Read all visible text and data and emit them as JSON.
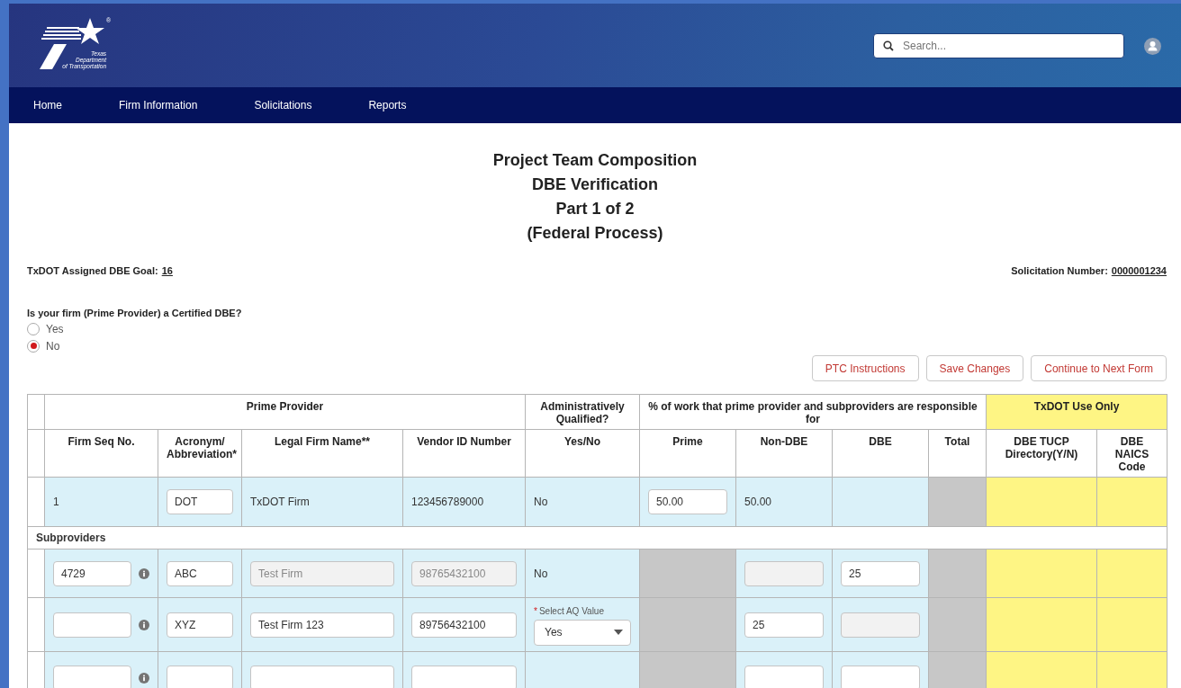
{
  "header": {
    "logo_text": [
      "Texas",
      "Department",
      "of Transportation"
    ],
    "logo_mark": "®",
    "search": {
      "placeholder": "Search..."
    }
  },
  "nav": [
    {
      "label": "Home"
    },
    {
      "label": "Firm Information"
    },
    {
      "label": "Solicitations"
    },
    {
      "label": "Reports"
    }
  ],
  "title_lines": [
    "Project Team Composition",
    "DBE Verification",
    "Part 1 of 2",
    "(Federal Process)"
  ],
  "goal": {
    "label": "TxDOT Assigned DBE Goal:",
    "value": "16"
  },
  "solicitation": {
    "label": "Solicitation Number:",
    "value": "0000001234"
  },
  "question": {
    "label": "Is your firm (Prime Provider) a Certified DBE?",
    "options": [
      {
        "label": "Yes",
        "selected": false
      },
      {
        "label": "No",
        "selected": true
      }
    ]
  },
  "buttons": [
    "PTC Instructions",
    "Save Changes",
    "Continue to Next Form"
  ],
  "table": {
    "group_headers": [
      {
        "label": "Prime Provider",
        "kind": "plain"
      },
      {
        "label": "Administratively Qualified?",
        "kind": "plain"
      },
      {
        "label": "% of work that prime provider and subproviders are responsible for",
        "kind": "plain"
      },
      {
        "label": "TxDOT Use Only",
        "kind": "txdot"
      }
    ],
    "columns": [
      "Firm Seq No.",
      "Acronym/ Abbreviation*",
      "Legal Firm Name**",
      "Vendor ID Number",
      "Yes/No",
      "Prime",
      "Non-DBE",
      "DBE",
      "Total",
      "DBE TUCP Directory(Y/N)",
      "DBE NAICS Code"
    ],
    "prime_row": [
      {
        "kind": "text",
        "value": "1"
      },
      {
        "kind": "input",
        "value": "DOT",
        "disabled": false
      },
      {
        "kind": "text",
        "value": "TxDOT Firm"
      },
      {
        "kind": "text",
        "value": "123456789000"
      },
      {
        "kind": "text",
        "value": "No"
      },
      {
        "kind": "input",
        "value": "50.00",
        "disabled": false
      },
      {
        "kind": "text",
        "value": "50.00"
      },
      {
        "kind": "empty"
      },
      {
        "kind": "blocked"
      },
      {
        "kind": "txdot"
      },
      {
        "kind": "txdot"
      }
    ],
    "section_label": "Subproviders",
    "sub_rows": [
      [
        {
          "kind": "input_info",
          "value": "4729",
          "disabled": false
        },
        {
          "kind": "input",
          "value": "ABC",
          "disabled": false
        },
        {
          "kind": "input",
          "value": "Test Firm",
          "disabled": true
        },
        {
          "kind": "input",
          "value": "98765432100",
          "disabled": true
        },
        {
          "kind": "text",
          "value": "No"
        },
        {
          "kind": "blocked"
        },
        {
          "kind": "input",
          "disabled": true
        },
        {
          "kind": "input",
          "value": "25",
          "disabled": false
        },
        {
          "kind": "blocked"
        },
        {
          "kind": "txdot"
        },
        {
          "kind": "txdot"
        }
      ],
      [
        {
          "kind": "input_info",
          "disabled": false
        },
        {
          "kind": "input",
          "value": "XYZ",
          "disabled": false
        },
        {
          "kind": "input",
          "value": "Test Firm 123",
          "disabled": false
        },
        {
          "kind": "input",
          "value": "89756432100",
          "disabled": false
        },
        {
          "kind": "select",
          "required_mark": "*",
          "label": "Select AQ Value",
          "value": "Yes"
        },
        {
          "kind": "blocked"
        },
        {
          "kind": "input",
          "value": "25",
          "disabled": false
        },
        {
          "kind": "input",
          "disabled": true
        },
        {
          "kind": "blocked"
        },
        {
          "kind": "txdot"
        },
        {
          "kind": "txdot"
        }
      ],
      [
        {
          "kind": "input_info",
          "disabled": false
        },
        {
          "kind": "input",
          "disabled": false
        },
        {
          "kind": "input",
          "disabled": false
        },
        {
          "kind": "input",
          "disabled": false
        },
        {
          "kind": "empty"
        },
        {
          "kind": "blocked"
        },
        {
          "kind": "input",
          "disabled": false
        },
        {
          "kind": "input",
          "disabled": false
        },
        {
          "kind": "blocked"
        },
        {
          "kind": "txdot"
        },
        {
          "kind": "txdot"
        }
      ]
    ]
  }
}
